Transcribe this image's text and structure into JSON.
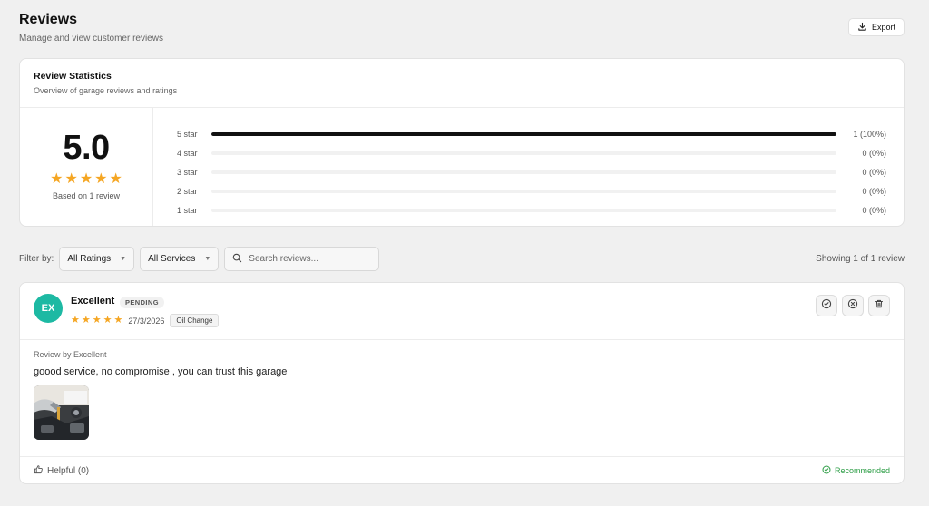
{
  "page": {
    "title": "Reviews",
    "subtitle": "Manage and view customer reviews",
    "export_label": "Export"
  },
  "stats": {
    "title": "Review Statistics",
    "subtitle": "Overview of garage reviews and ratings",
    "average": "5.0",
    "star_rating": 5,
    "based_on": "Based on 1 review",
    "distribution": [
      {
        "label": "5 star",
        "fraction": 1.0,
        "count": "1 (100%)"
      },
      {
        "label": "4 star",
        "fraction": 0.0,
        "count": "0 (0%)"
      },
      {
        "label": "3 star",
        "fraction": 0.0,
        "count": "0 (0%)"
      },
      {
        "label": "2 star",
        "fraction": 0.0,
        "count": "0 (0%)"
      },
      {
        "label": "1 star",
        "fraction": 0.0,
        "count": "0 (0%)"
      }
    ]
  },
  "filters": {
    "label": "Filter by:",
    "rating_select": "All Ratings",
    "service_select": "All Services",
    "search_placeholder": "Search reviews...",
    "showing": "Showing 1 of 1 review"
  },
  "review": {
    "avatar_initials": "EX",
    "name": "Excellent",
    "status": "PENDING",
    "star_rating": 5,
    "date": "27/3/2026",
    "service": "Oil Change",
    "review_by": "Review by Excellent",
    "text": "goood service, no compromise , you can trust this garage",
    "helpful": "Helpful (0)",
    "recommended": "Recommended"
  },
  "colors": {
    "star": "#f5a623",
    "avatar": "#1db9a3",
    "recommended": "#2e9e47",
    "bar_fill": "#111111"
  }
}
